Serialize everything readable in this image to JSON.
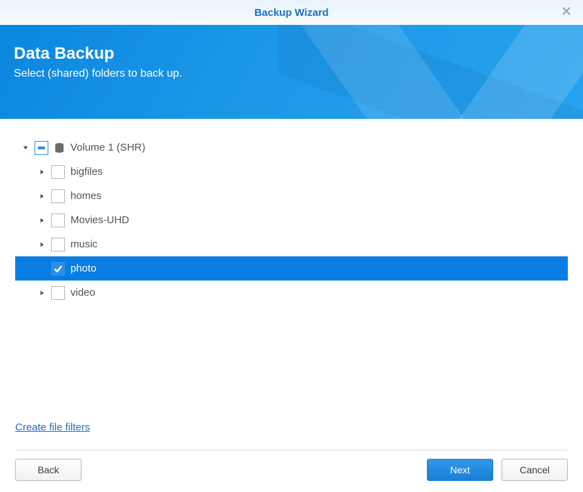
{
  "window": {
    "title": "Backup Wizard"
  },
  "hero": {
    "heading": "Data Backup",
    "sub": "Select (shared) folders to back up."
  },
  "tree": {
    "root": {
      "label": "Volume 1 (SHR)",
      "state": "partial"
    },
    "items": [
      {
        "label": "bigfiles",
        "state": "unchecked",
        "selected": false,
        "hasCaret": true
      },
      {
        "label": "homes",
        "state": "unchecked",
        "selected": false,
        "hasCaret": true
      },
      {
        "label": "Movies-UHD",
        "state": "unchecked",
        "selected": false,
        "hasCaret": true
      },
      {
        "label": "music",
        "state": "unchecked",
        "selected": false,
        "hasCaret": true
      },
      {
        "label": "photo",
        "state": "checked",
        "selected": true,
        "hasCaret": false
      },
      {
        "label": "video",
        "state": "unchecked",
        "selected": false,
        "hasCaret": true
      }
    ]
  },
  "link": {
    "create_filters": "Create file filters"
  },
  "buttons": {
    "back": "Back",
    "next": "Next",
    "cancel": "Cancel"
  }
}
